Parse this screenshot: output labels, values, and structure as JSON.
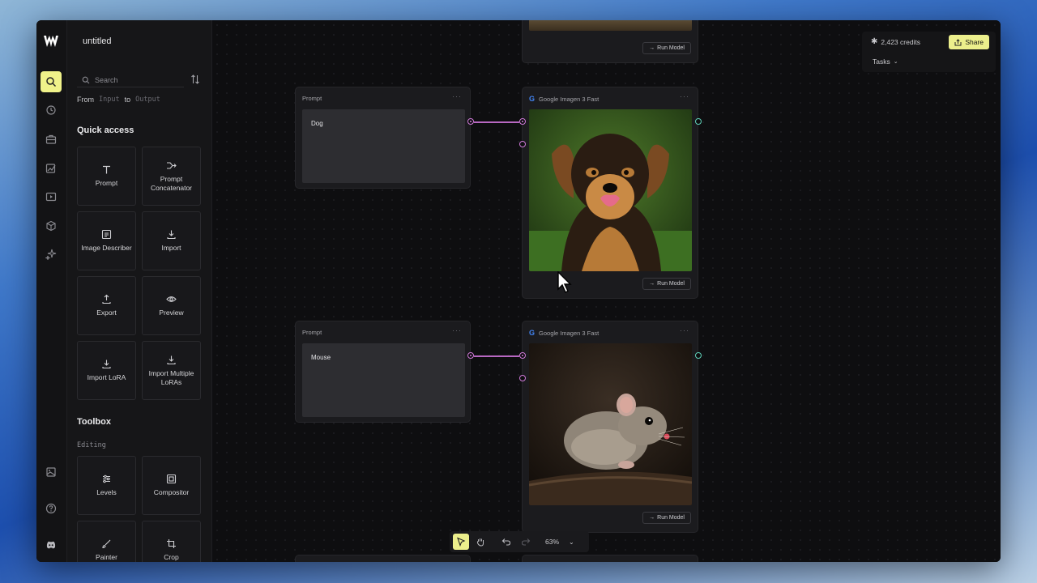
{
  "app": {
    "title": "untitled"
  },
  "rail": {
    "items": [
      "search-icon",
      "history-icon",
      "toolbox-icon",
      "edit-image-icon",
      "video-icon",
      "3d-icon",
      "sparkle-icon"
    ],
    "bottom": [
      "gallery-icon",
      "help-icon",
      "discord-icon"
    ]
  },
  "panel": {
    "search_placeholder": "Search",
    "from_label": "From",
    "input_label": "Input",
    "to_label": "to",
    "output_label": "Output",
    "quick_access_title": "Quick access",
    "quick_access": [
      {
        "label": "Prompt"
      },
      {
        "label": "Prompt Concatenator"
      },
      {
        "label": "Image Describer"
      },
      {
        "label": "Import"
      },
      {
        "label": "Export"
      },
      {
        "label": "Preview"
      },
      {
        "label": "Import LoRA"
      },
      {
        "label": "Import Multiple LoRAs"
      }
    ],
    "toolbox_title": "Toolbox",
    "editing_label": "Editing",
    "toolbox": [
      {
        "label": "Levels"
      },
      {
        "label": "Compositor"
      },
      {
        "label": "Painter"
      },
      {
        "label": "Crop"
      }
    ]
  },
  "canvas": {
    "nodes": [
      {
        "type": "Prompt",
        "text": "Dog"
      },
      {
        "type": "Google Imagen 3 Fast",
        "subject": "dog",
        "run_label": "Run Model"
      },
      {
        "type": "Prompt",
        "text": "Mouse"
      },
      {
        "type": "Google Imagen 3 Fast",
        "subject": "mouse",
        "run_label": "Run Model"
      }
    ],
    "top_run_label": "Run Model"
  },
  "topbar": {
    "credits": "2,423 credits",
    "share_label": "Share",
    "tasks_label": "Tasks"
  },
  "toolbar": {
    "zoom": "63%"
  },
  "colors": {
    "accent": "#ecef8c",
    "port_pink": "#d07ad9",
    "port_green": "#5fd1b8"
  }
}
